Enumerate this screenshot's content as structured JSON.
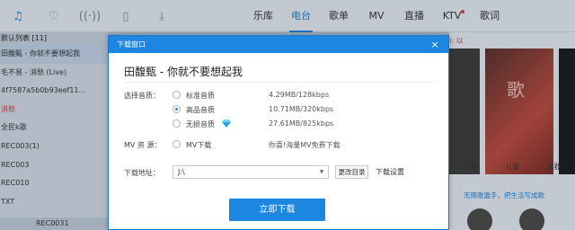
{
  "nav": {
    "items": [
      {
        "label": "乐库",
        "active": false
      },
      {
        "label": "电台",
        "active": true
      },
      {
        "label": "歌单",
        "active": false
      },
      {
        "label": "MV",
        "active": false
      },
      {
        "label": "直播",
        "active": false
      },
      {
        "label": "KTV",
        "active": false,
        "dot": true
      },
      {
        "label": "歌词",
        "active": false
      }
    ]
  },
  "top_icons": [
    "music-note-icon",
    "heart-icon",
    "radio-wave-icon",
    "phone-icon",
    "download-icon"
  ],
  "sidebar": {
    "header": "默认列表 [11]",
    "items": [
      {
        "label": "田馥甄 - 你就不要想起我",
        "selected": true
      },
      {
        "label": "毛不易 - 消愁 (Live)"
      },
      {
        "label": "4f7587a5b0b93eef11..."
      },
      {
        "label": "消愁",
        "red": true
      },
      {
        "label": "全民k歌"
      },
      {
        "label": "REC003(1)"
      },
      {
        "label": "REC003"
      },
      {
        "label": "REC010"
      },
      {
        "label": "TXT"
      }
    ],
    "bottom": "REC0031"
  },
  "right_pane": {
    "link": "I: 以",
    "categories": [
      "人群",
      "儿童",
      "乐器"
    ],
    "promo": "无限歌遨手，把生活写成歌"
  },
  "dialog": {
    "title": "下载窗口",
    "close": "×",
    "song": "田馥甄 - 你就不要想起我",
    "quality_label": "选择音质：",
    "options": [
      {
        "label": "标准音质",
        "size": "4.29MB/128kbps",
        "checked": false
      },
      {
        "label": "高品音质",
        "size": "10.71MB/320kbps",
        "checked": true
      },
      {
        "label": "无损音质",
        "size": "27.61MB/825kbps",
        "checked": false,
        "icon": "diamond-icon"
      }
    ],
    "mv_label": "MV 资 源：",
    "mv_option": "MV下载",
    "mv_note": "你喜!海量MV免费下载",
    "path_label": "下载地址：",
    "path_value": "J:\\",
    "change_dir": "更改目录",
    "settings": "下载设置",
    "download_button": "立即下载"
  },
  "colors": {
    "accent": "#1c86e0",
    "alert": "#d43c3c",
    "dialog_bg": "#ffffff"
  }
}
